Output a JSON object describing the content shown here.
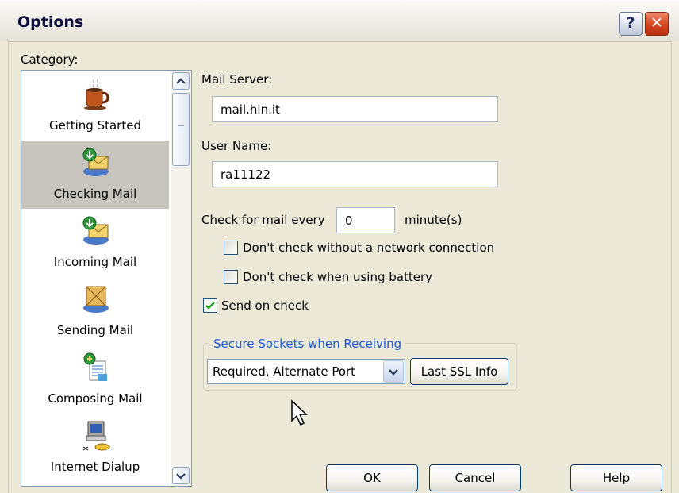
{
  "window": {
    "title": "Options",
    "help_button": "?",
    "close_button": "✕"
  },
  "category": {
    "label": "Category:",
    "items": [
      {
        "label": "Getting Started",
        "icon": "coffee-cup-icon",
        "selected": false
      },
      {
        "label": "Checking Mail",
        "icon": "checking-mail-icon",
        "selected": true
      },
      {
        "label": "Incoming Mail",
        "icon": "incoming-mail-icon",
        "selected": false
      },
      {
        "label": "Sending Mail",
        "icon": "sending-mail-icon",
        "selected": false
      },
      {
        "label": "Composing Mail",
        "icon": "composing-mail-icon",
        "selected": false
      },
      {
        "label": "Internet Dialup",
        "icon": "dialup-computer-icon",
        "selected": false
      }
    ]
  },
  "form": {
    "mail_server_label": "Mail Server:",
    "mail_server_value": "mail.hln.it",
    "user_name_label": "User Name:",
    "user_name_value": "ra11122",
    "check_every_label": "Check for mail every",
    "check_every_value": "0",
    "check_every_unit": "minute(s)",
    "no_network_label": "Don't check without a network connection",
    "no_network_checked": false,
    "battery_label": "Don't check when using battery",
    "battery_checked": false,
    "send_on_check_label": "Send on check",
    "send_on_check_checked": true,
    "ssl_group_label": "Secure Sockets when Receiving",
    "ssl_value": "Required, Alternate Port",
    "last_ssl_label": "Last SSL Info"
  },
  "buttons": {
    "ok": "OK",
    "cancel": "Cancel",
    "help": "Help"
  },
  "colors": {
    "accent": "#1d5bd6",
    "selection": "#c7c5bd",
    "close_red": "#d5451f"
  }
}
